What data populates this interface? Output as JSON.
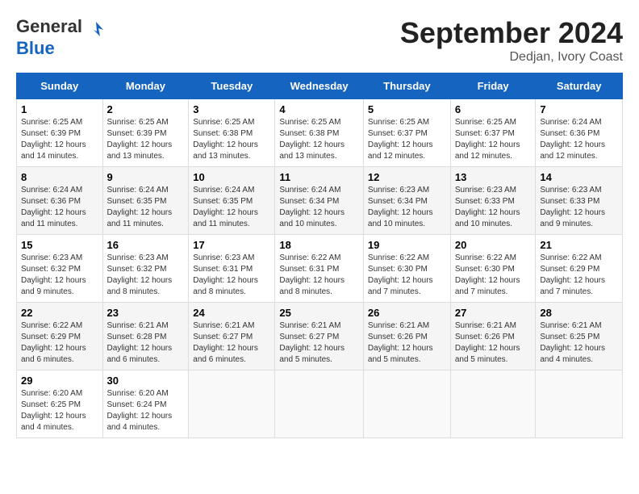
{
  "header": {
    "logo_general": "General",
    "logo_blue": "Blue",
    "month": "September 2024",
    "location": "Dedjan, Ivory Coast"
  },
  "days_of_week": [
    "Sunday",
    "Monday",
    "Tuesday",
    "Wednesday",
    "Thursday",
    "Friday",
    "Saturday"
  ],
  "weeks": [
    [
      {
        "day": "1",
        "sunrise": "6:25 AM",
        "sunset": "6:39 PM",
        "daylight": "12 hours and 14 minutes."
      },
      {
        "day": "2",
        "sunrise": "6:25 AM",
        "sunset": "6:39 PM",
        "daylight": "12 hours and 13 minutes."
      },
      {
        "day": "3",
        "sunrise": "6:25 AM",
        "sunset": "6:38 PM",
        "daylight": "12 hours and 13 minutes."
      },
      {
        "day": "4",
        "sunrise": "6:25 AM",
        "sunset": "6:38 PM",
        "daylight": "12 hours and 13 minutes."
      },
      {
        "day": "5",
        "sunrise": "6:25 AM",
        "sunset": "6:37 PM",
        "daylight": "12 hours and 12 minutes."
      },
      {
        "day": "6",
        "sunrise": "6:25 AM",
        "sunset": "6:37 PM",
        "daylight": "12 hours and 12 minutes."
      },
      {
        "day": "7",
        "sunrise": "6:24 AM",
        "sunset": "6:36 PM",
        "daylight": "12 hours and 12 minutes."
      }
    ],
    [
      {
        "day": "8",
        "sunrise": "6:24 AM",
        "sunset": "6:36 PM",
        "daylight": "12 hours and 11 minutes."
      },
      {
        "day": "9",
        "sunrise": "6:24 AM",
        "sunset": "6:35 PM",
        "daylight": "12 hours and 11 minutes."
      },
      {
        "day": "10",
        "sunrise": "6:24 AM",
        "sunset": "6:35 PM",
        "daylight": "12 hours and 11 minutes."
      },
      {
        "day": "11",
        "sunrise": "6:24 AM",
        "sunset": "6:34 PM",
        "daylight": "12 hours and 10 minutes."
      },
      {
        "day": "12",
        "sunrise": "6:23 AM",
        "sunset": "6:34 PM",
        "daylight": "12 hours and 10 minutes."
      },
      {
        "day": "13",
        "sunrise": "6:23 AM",
        "sunset": "6:33 PM",
        "daylight": "12 hours and 10 minutes."
      },
      {
        "day": "14",
        "sunrise": "6:23 AM",
        "sunset": "6:33 PM",
        "daylight": "12 hours and 9 minutes."
      }
    ],
    [
      {
        "day": "15",
        "sunrise": "6:23 AM",
        "sunset": "6:32 PM",
        "daylight": "12 hours and 9 minutes."
      },
      {
        "day": "16",
        "sunrise": "6:23 AM",
        "sunset": "6:32 PM",
        "daylight": "12 hours and 8 minutes."
      },
      {
        "day": "17",
        "sunrise": "6:23 AM",
        "sunset": "6:31 PM",
        "daylight": "12 hours and 8 minutes."
      },
      {
        "day": "18",
        "sunrise": "6:22 AM",
        "sunset": "6:31 PM",
        "daylight": "12 hours and 8 minutes."
      },
      {
        "day": "19",
        "sunrise": "6:22 AM",
        "sunset": "6:30 PM",
        "daylight": "12 hours and 7 minutes."
      },
      {
        "day": "20",
        "sunrise": "6:22 AM",
        "sunset": "6:30 PM",
        "daylight": "12 hours and 7 minutes."
      },
      {
        "day": "21",
        "sunrise": "6:22 AM",
        "sunset": "6:29 PM",
        "daylight": "12 hours and 7 minutes."
      }
    ],
    [
      {
        "day": "22",
        "sunrise": "6:22 AM",
        "sunset": "6:29 PM",
        "daylight": "12 hours and 6 minutes."
      },
      {
        "day": "23",
        "sunrise": "6:21 AM",
        "sunset": "6:28 PM",
        "daylight": "12 hours and 6 minutes."
      },
      {
        "day": "24",
        "sunrise": "6:21 AM",
        "sunset": "6:27 PM",
        "daylight": "12 hours and 6 minutes."
      },
      {
        "day": "25",
        "sunrise": "6:21 AM",
        "sunset": "6:27 PM",
        "daylight": "12 hours and 5 minutes."
      },
      {
        "day": "26",
        "sunrise": "6:21 AM",
        "sunset": "6:26 PM",
        "daylight": "12 hours and 5 minutes."
      },
      {
        "day": "27",
        "sunrise": "6:21 AM",
        "sunset": "6:26 PM",
        "daylight": "12 hours and 5 minutes."
      },
      {
        "day": "28",
        "sunrise": "6:21 AM",
        "sunset": "6:25 PM",
        "daylight": "12 hours and 4 minutes."
      }
    ],
    [
      {
        "day": "29",
        "sunrise": "6:20 AM",
        "sunset": "6:25 PM",
        "daylight": "12 hours and 4 minutes."
      },
      {
        "day": "30",
        "sunrise": "6:20 AM",
        "sunset": "6:24 PM",
        "daylight": "12 hours and 4 minutes."
      },
      null,
      null,
      null,
      null,
      null
    ]
  ]
}
